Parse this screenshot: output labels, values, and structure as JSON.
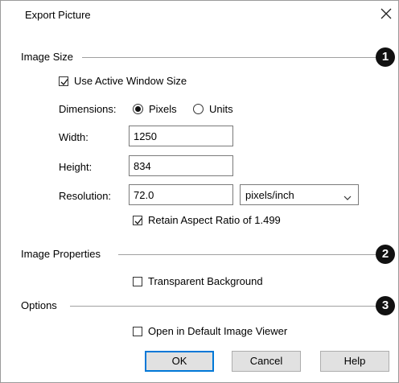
{
  "dialog": {
    "title": "Export Picture",
    "close_icon": "close-icon"
  },
  "image_size": {
    "label": "Image Size",
    "marker": "1",
    "use_active_window": {
      "label": "Use Active Window Size",
      "checked": true
    },
    "dimensions": {
      "label": "Dimensions:",
      "options": [
        "Pixels",
        "Units"
      ],
      "selected": "Pixels"
    },
    "width": {
      "label": "Width:",
      "value": "1250"
    },
    "height": {
      "label": "Height:",
      "value": "834"
    },
    "resolution": {
      "label": "Resolution:",
      "value": "72.0",
      "unit": "pixels/inch"
    },
    "retain_aspect": {
      "label": "Retain Aspect Ratio of 1.499",
      "checked": true
    }
  },
  "image_properties": {
    "label": "Image Properties",
    "marker": "2",
    "transparent_background": {
      "label": "Transparent Background",
      "checked": false
    }
  },
  "options": {
    "label": "Options",
    "marker": "3",
    "open_default_viewer": {
      "label": "Open in Default Image Viewer",
      "checked": false
    }
  },
  "buttons": {
    "ok": "OK",
    "cancel": "Cancel",
    "help": "Help"
  },
  "colors": {
    "accent": "#0078d7",
    "marker_bg": "#111111"
  }
}
